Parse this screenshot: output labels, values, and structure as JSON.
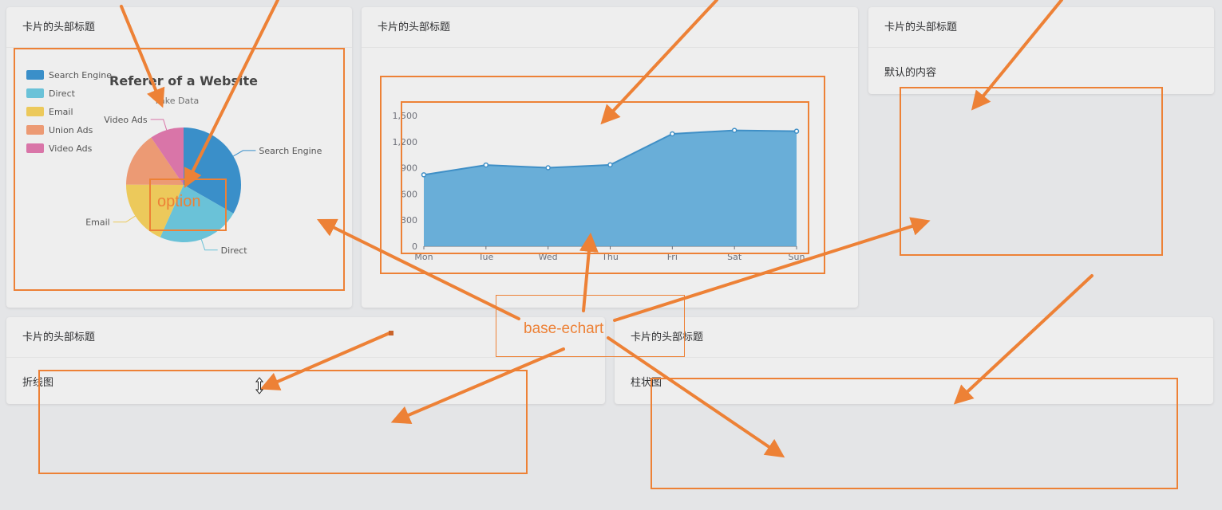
{
  "cards": {
    "pie_card": {
      "header": "卡片的头部标题"
    },
    "line_card": {
      "header": "卡片的头部标题"
    },
    "default_card": {
      "header": "卡片的头部标题",
      "body": "默认的内容"
    },
    "bottom_left_card": {
      "header": "卡片的头部标题",
      "body": "折线图"
    },
    "bottom_right_card": {
      "header": "卡片的头部标题",
      "body": "柱状图"
    }
  },
  "annotations": {
    "option_label": "option",
    "base_echart_label": "base-echart",
    "accent_color": "#ed8136"
  },
  "chart_data": [
    {
      "type": "pie",
      "title": "Referer of a Website",
      "subtitle": "Fake Data",
      "legend_position": "top-left",
      "legend": [
        "Search Engine",
        "Direct",
        "Email",
        "Union Ads",
        "Video Ads"
      ],
      "slices": [
        {
          "name": "Search Engine",
          "value": 1048,
          "color": "#3a8fc9"
        },
        {
          "name": "Direct",
          "value": 735,
          "color": "#6ac2d8"
        },
        {
          "name": "Email",
          "value": 580,
          "color": "#ecc95b"
        },
        {
          "name": "Union Ads",
          "value": 484,
          "color": "#ec9a74"
        },
        {
          "name": "Video Ads",
          "value": 300,
          "color": "#d975a8"
        }
      ]
    },
    {
      "type": "area",
      "categories": [
        "Mon",
        "Tue",
        "Wed",
        "Thu",
        "Fri",
        "Sat",
        "Sun"
      ],
      "values": [
        820,
        932,
        901,
        934,
        1290,
        1330,
        1320
      ],
      "ylim": [
        0,
        1500
      ],
      "yticks": [
        0,
        300,
        600,
        900,
        1200,
        1500
      ],
      "ytick_labels": [
        "0",
        "300",
        "600",
        "900",
        "1,200",
        "1,500"
      ],
      "color": "#5aa6d5",
      "grid": false
    }
  ]
}
